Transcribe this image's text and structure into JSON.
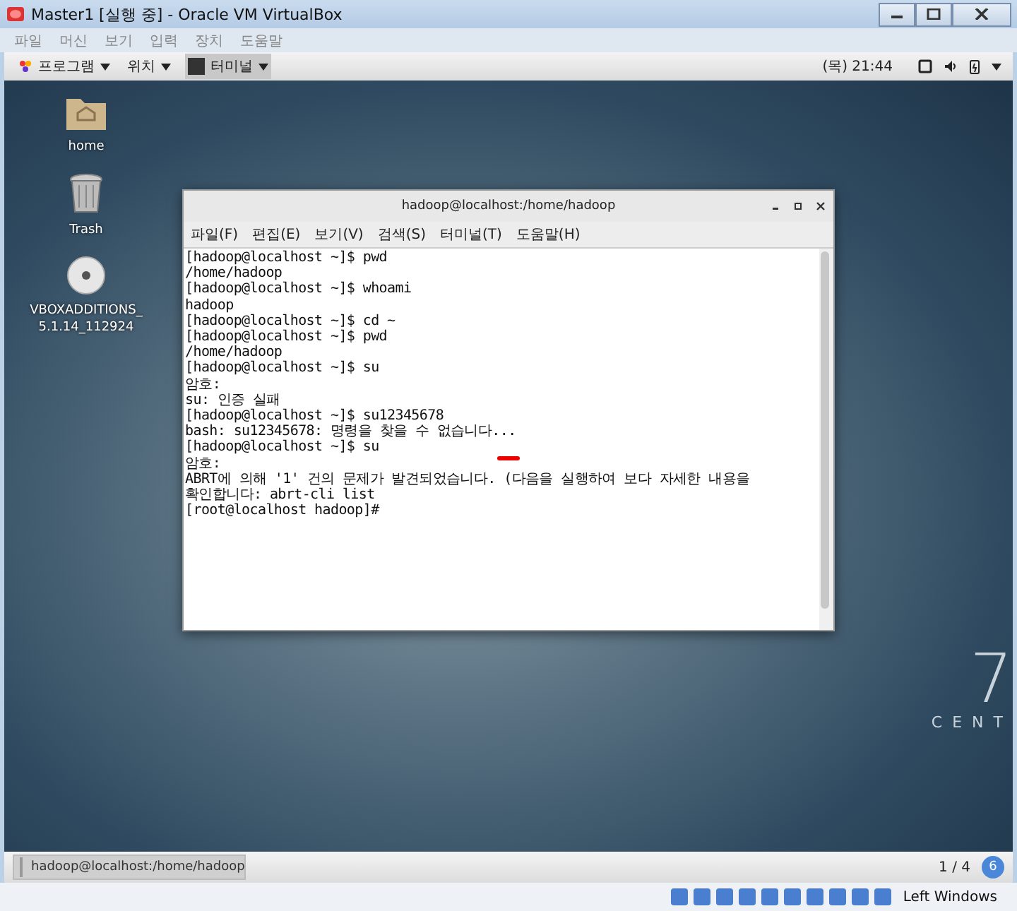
{
  "window": {
    "title": "Master1 [실행 중] - Oracle VM VirtualBox"
  },
  "vbox_menu": [
    "파일",
    "머신",
    "보기",
    "입력",
    "장치",
    "도움말"
  ],
  "top_bar": {
    "applications": "프로그램",
    "places": "위치",
    "active_app": "터미널",
    "clock": "(목) 21:44"
  },
  "desktop_icons": [
    {
      "kind": "folder",
      "label": [
        "home"
      ]
    },
    {
      "kind": "trash",
      "label": [
        "Trash"
      ]
    },
    {
      "kind": "disc",
      "label": [
        "VBOXADDITIONS_",
        "5.1.14_112924"
      ]
    }
  ],
  "desktop_logo": {
    "numeral": "7",
    "word": "CENT"
  },
  "terminal": {
    "title": "hadoop@localhost:/home/hadoop",
    "menu": [
      "파일(F)",
      "편집(E)",
      "보기(V)",
      "검색(S)",
      "터미널(T)",
      "도움말(H)"
    ],
    "lines": [
      "[hadoop@localhost ~]$ pwd",
      "/home/hadoop",
      "[hadoop@localhost ~]$ whoami",
      "hadoop",
      "[hadoop@localhost ~]$ cd ~",
      "[hadoop@localhost ~]$ pwd",
      "/home/hadoop",
      "[hadoop@localhost ~]$ su",
      "암호:",
      "su: 인증 실패",
      "[hadoop@localhost ~]$ su12345678",
      "bash: su12345678: 명령을 찾을 수 없습니다...",
      "[hadoop@localhost ~]$ su",
      "암호:",
      "ABRT에 의해 '1' 건의 문제가 발견되었습니다. (다음을 실행하여 보다 자세한 내용을",
      "확인합니다: abrt-cli list",
      "[root@localhost hadoop]#"
    ]
  },
  "taskbar": {
    "task": "hadoop@localhost:/home/hadoop",
    "workspace": "1 / 4",
    "notification_count": "6"
  },
  "status_bar": {
    "host_key": "Left Windows"
  }
}
